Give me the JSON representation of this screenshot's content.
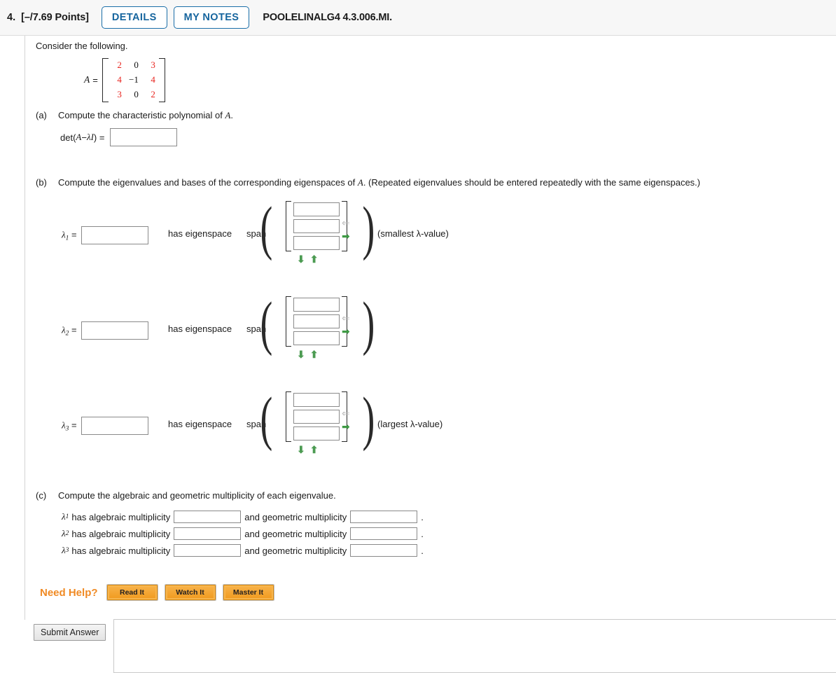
{
  "header": {
    "question_number": "4.",
    "points": "[–/7.69 Points]",
    "details_label": "DETAILS",
    "my_notes_label": "MY NOTES",
    "problem_code": "POOLELINALG4 4.3.006.MI.",
    "accent_color": "#16659e"
  },
  "intro": "Consider the following.",
  "matrix": {
    "label": "A",
    "equals": "=",
    "rows": [
      [
        {
          "v": "2",
          "c": "red"
        },
        {
          "v": "0",
          "c": "blk"
        },
        {
          "v": "3",
          "c": "red"
        }
      ],
      [
        {
          "v": "4",
          "c": "red"
        },
        {
          "v": "−1",
          "c": "blk"
        },
        {
          "v": "4",
          "c": "red"
        }
      ],
      [
        {
          "v": "3",
          "c": "red"
        },
        {
          "v": "0",
          "c": "blk"
        },
        {
          "v": "2",
          "c": "red"
        }
      ]
    ],
    "entry_color_red": "#e8251f",
    "entry_color_black": "#111111"
  },
  "parts": {
    "a": {
      "letter": "(a)",
      "prompt_pre": "Compute the characteristic polynomial of ",
      "prompt_var": "A",
      "prompt_post": ".",
      "det_label_pre": "det(",
      "det_label_var": "A",
      "det_label_mid": " − ",
      "det_label_lambda": "λI",
      "det_label_post": ") =",
      "answer_value": "",
      "answer_placeholder": ""
    },
    "b": {
      "letter": "(b)",
      "prompt": "Compute the eigenvalues and bases of the corresponding eigenspaces of ",
      "prompt_var": "A",
      "prompt_post": ". (Repeated eigenvalues should be entered repeatedly with the same eigenspaces.)",
      "has_eigenspace_label": "has eigenspace",
      "span_label": "span",
      "rows": [
        {
          "lambda": "λ",
          "sub": "1",
          "equals": "=",
          "value": "",
          "vector": [
            "",
            "",
            ""
          ],
          "note": "(smallest λ-value)",
          "left_arrow": "⇐",
          "right_arrow": "➡",
          "down_arrow": "⬇",
          "up_arrow": "⬆"
        },
        {
          "lambda": "λ",
          "sub": "2",
          "equals": "=",
          "value": "",
          "vector": [
            "",
            "",
            ""
          ],
          "note": "",
          "left_arrow": "⇐",
          "right_arrow": "➡",
          "down_arrow": "⬇",
          "up_arrow": "⬆"
        },
        {
          "lambda": "λ",
          "sub": "3",
          "equals": "=",
          "value": "",
          "vector": [
            "",
            "",
            ""
          ],
          "note": "(largest λ-value)",
          "left_arrow": "⇐",
          "right_arrow": "➡",
          "down_arrow": "⬇",
          "up_arrow": "⬆"
        }
      ]
    },
    "c": {
      "letter": "(c)",
      "prompt": "Compute the algebraic and geometric multiplicity of each eigenvalue.",
      "text_alg": "has algebraic multiplicity",
      "text_geo": "and geometric multiplicity",
      "period": ".",
      "rows": [
        {
          "lambda": "λ",
          "sub": "1",
          "algebraic": "",
          "geometric": ""
        },
        {
          "lambda": "λ",
          "sub": "2",
          "algebraic": "",
          "geometric": ""
        },
        {
          "lambda": "λ",
          "sub": "3",
          "algebraic": "",
          "geometric": ""
        }
      ]
    }
  },
  "need_help": {
    "label": "Need Help?",
    "label_color": "#f08a24",
    "buttons": [
      "Read It",
      "Watch It",
      "Master It"
    ]
  },
  "submit": {
    "label": "Submit Answer"
  }
}
